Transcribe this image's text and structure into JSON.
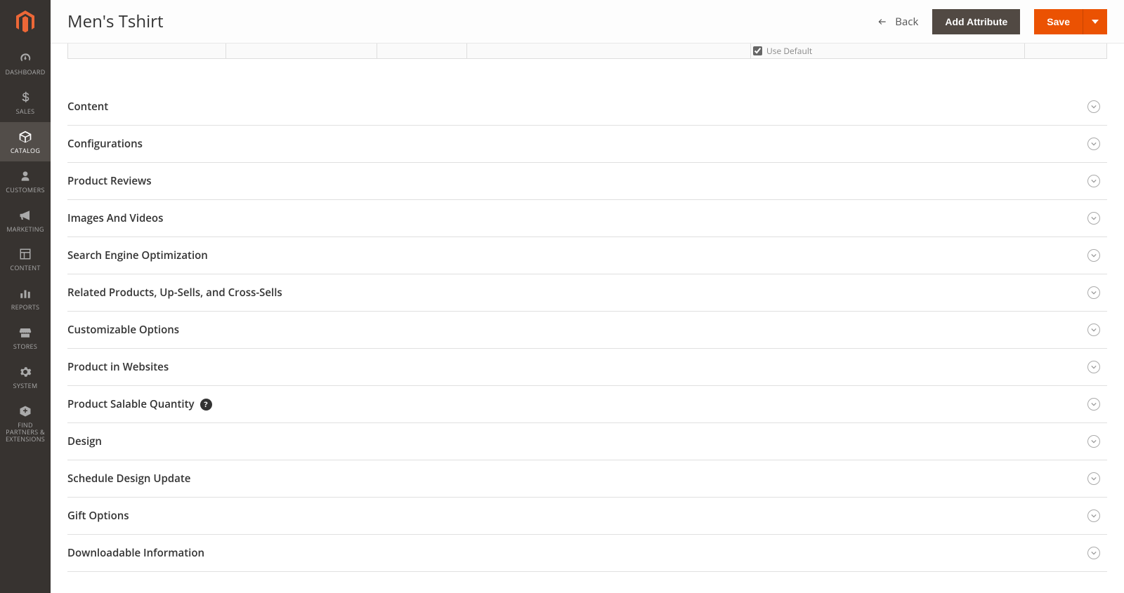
{
  "page": {
    "title": "Men's Tshirt"
  },
  "header": {
    "back_label": "Back",
    "add_attribute_label": "Add Attribute",
    "save_label": "Save"
  },
  "sidebar": {
    "items": [
      {
        "label": "DASHBOARD"
      },
      {
        "label": "SALES"
      },
      {
        "label": "CATALOG"
      },
      {
        "label": "CUSTOMERS"
      },
      {
        "label": "MARKETING"
      },
      {
        "label": "CONTENT"
      },
      {
        "label": "REPORTS"
      },
      {
        "label": "STORES"
      },
      {
        "label": "SYSTEM"
      },
      {
        "label": "FIND PARTNERS & EXTENSIONS"
      }
    ]
  },
  "checkbox": {
    "use_default_label": "Use Default",
    "checked": true
  },
  "sections": [
    {
      "title": "Content",
      "help": false
    },
    {
      "title": "Configurations",
      "help": false
    },
    {
      "title": "Product Reviews",
      "help": false
    },
    {
      "title": "Images And Videos",
      "help": false
    },
    {
      "title": "Search Engine Optimization",
      "help": false
    },
    {
      "title": "Related Products, Up-Sells, and Cross-Sells",
      "help": false
    },
    {
      "title": "Customizable Options",
      "help": false
    },
    {
      "title": "Product in Websites",
      "help": false
    },
    {
      "title": "Product Salable Quantity",
      "help": true
    },
    {
      "title": "Design",
      "help": false
    },
    {
      "title": "Schedule Design Update",
      "help": false
    },
    {
      "title": "Gift Options",
      "help": false
    },
    {
      "title": "Downloadable Information",
      "help": false
    }
  ]
}
